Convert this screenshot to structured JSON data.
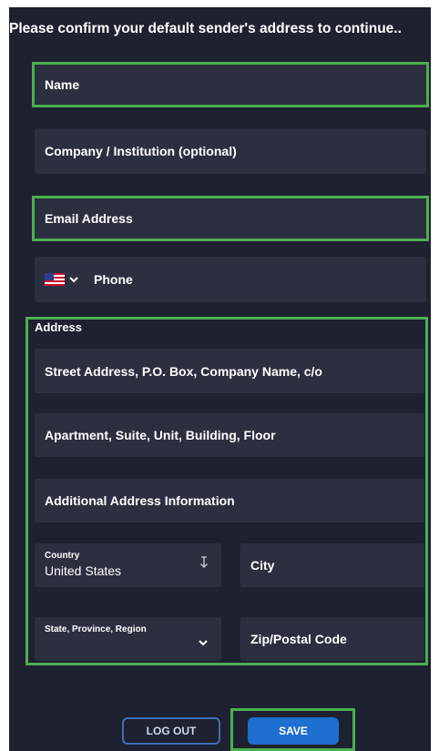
{
  "title": "Please confirm your default sender's address to continue..",
  "fields": {
    "name": "Name",
    "company": "Company / Institution (optional)",
    "email": "Email Address",
    "phone": "Phone",
    "phone_country_flag": "us-flag-icon"
  },
  "address": {
    "section_label": "Address",
    "street": "Street Address, P.O. Box, Company Name, c/o",
    "apartment": "Apartment, Suite, Unit, Building, Floor",
    "additional": "Additional Address Information",
    "country_label": "Country",
    "country_value": "United States",
    "city": "City",
    "state_label": "State, Province, Region",
    "zip": "Zip/Postal Code"
  },
  "buttons": {
    "logout": "LOG OUT",
    "save": "SAVE"
  },
  "colors": {
    "background": "#1e2130",
    "field": "#2c2f40",
    "highlight": "#4caf50",
    "save_button": "#1f6fd1",
    "logout_border": "#3f6db5"
  }
}
